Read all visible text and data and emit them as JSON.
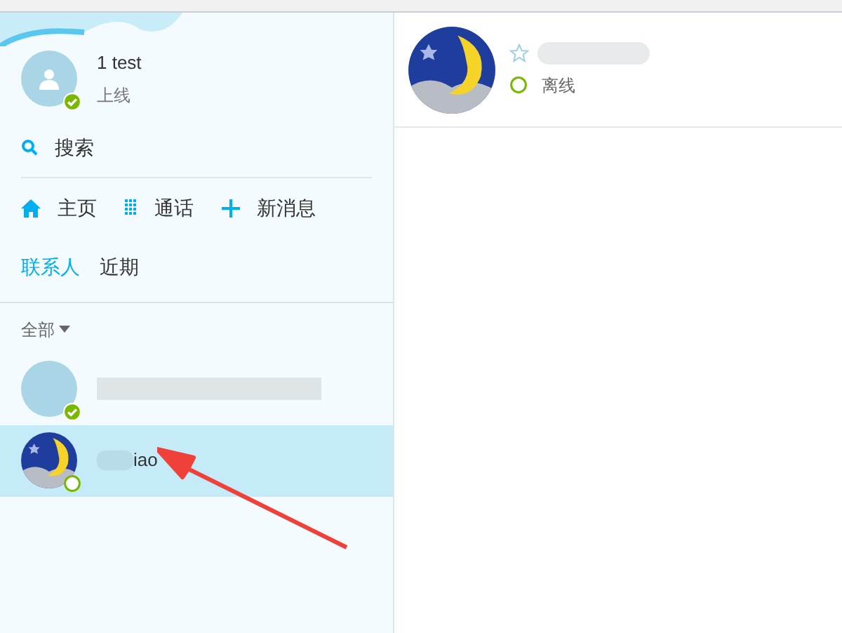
{
  "profile": {
    "name": "1 test",
    "status": "上线",
    "online": true
  },
  "search": {
    "label": "搜索"
  },
  "nav": [
    {
      "kind": "home",
      "label": "主页"
    },
    {
      "kind": "dialpad",
      "label": "通话"
    },
    {
      "kind": "plus",
      "label": "新消息"
    }
  ],
  "tabs": [
    {
      "label": "联系人",
      "selected": true
    },
    {
      "label": "近期",
      "selected": false
    }
  ],
  "filter": {
    "label": "全部"
  },
  "contacts": [
    {
      "online": true,
      "selected": false
    },
    {
      "name": "iao",
      "online": false,
      "selected": true
    }
  ],
  "detail": {
    "status": "离线",
    "online": false
  }
}
